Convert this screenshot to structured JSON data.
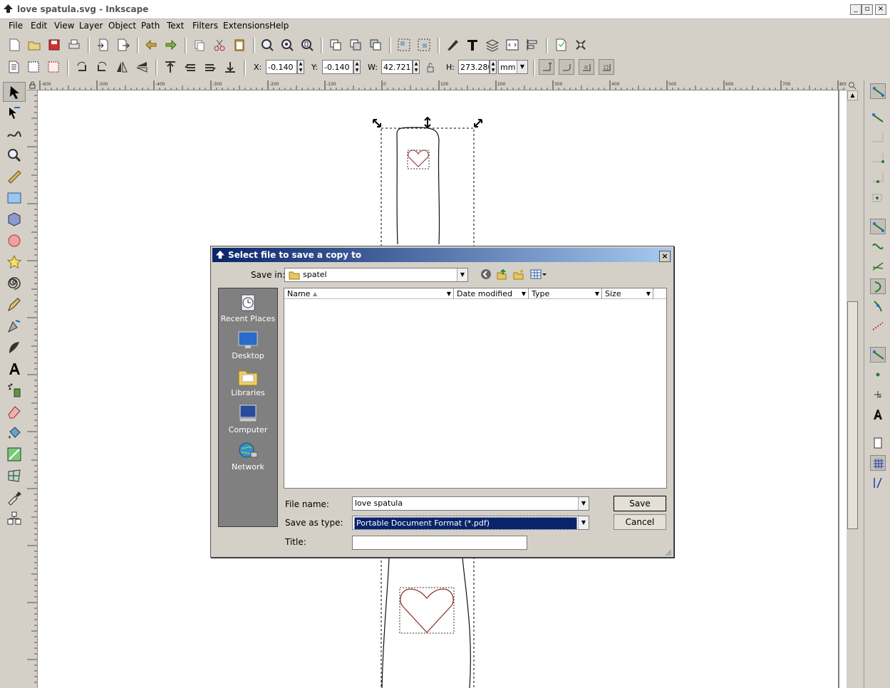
{
  "window": {
    "title": "love spatula.svg - Inkscape",
    "controls": [
      "_",
      "▫",
      "×"
    ]
  },
  "menu": [
    "File",
    "Edit",
    "View",
    "Layer",
    "Object",
    "Path",
    "Text",
    "Filters",
    "Extensions",
    "Help"
  ],
  "toolbar2": {
    "x_label": "X:",
    "x_value": "-0.140",
    "y_label": "Y:",
    "y_value": "-0.140",
    "w_label": "W:",
    "w_value": "42.721",
    "h_label": "H:",
    "h_value": "273.280",
    "unit": "mm"
  },
  "ruler": {
    "h_ticks": [
      "-600",
      "-500",
      "-400",
      "-300",
      "-200",
      "-100",
      "0",
      "100",
      "200",
      "300",
      "400",
      "500",
      "600",
      "700",
      "800"
    ]
  },
  "dialog": {
    "title": "Select file to save a copy to",
    "close": "×",
    "save_in_label": "Save in:",
    "save_in_value": "spatel",
    "columns": [
      "Name",
      "Date modified",
      "Type",
      "Size"
    ],
    "places": [
      {
        "label": "Recent Places",
        "icon": "recent-places-icon"
      },
      {
        "label": "Desktop",
        "icon": "desktop-icon"
      },
      {
        "label": "Libraries",
        "icon": "libraries-icon"
      },
      {
        "label": "Computer",
        "icon": "computer-icon"
      },
      {
        "label": "Network",
        "icon": "network-icon"
      }
    ],
    "file_name_label": "File name:",
    "file_name_value": "love spatula",
    "save_type_label": "Save as type:",
    "save_type_value": "Portable Document Format (*.pdf)",
    "title_label": "Title:",
    "title_value": "",
    "save_button": "Save",
    "cancel_button": "Cancel"
  },
  "colors": {
    "dialog_title_start": "#0a246a",
    "dialog_title_end": "#a6caf0",
    "heart_stroke": "#8b2a2a",
    "chrome": "#d4d0c8"
  }
}
